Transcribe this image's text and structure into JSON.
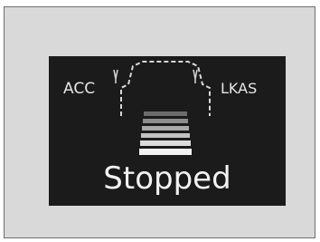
{
  "display": {
    "acc_label": "ACC",
    "lkas_label": "LKAS",
    "status_text": "Stopped"
  },
  "icons": {
    "lead_vehicle": "lead-vehicle-outline-icon",
    "lane": "lane-bars-icon"
  },
  "colors": {
    "panel_background": "#d9d9d9",
    "display_background": "#1b1b1b",
    "text": "#f2f2f2",
    "dashed_outline": "#d8d8d8"
  }
}
